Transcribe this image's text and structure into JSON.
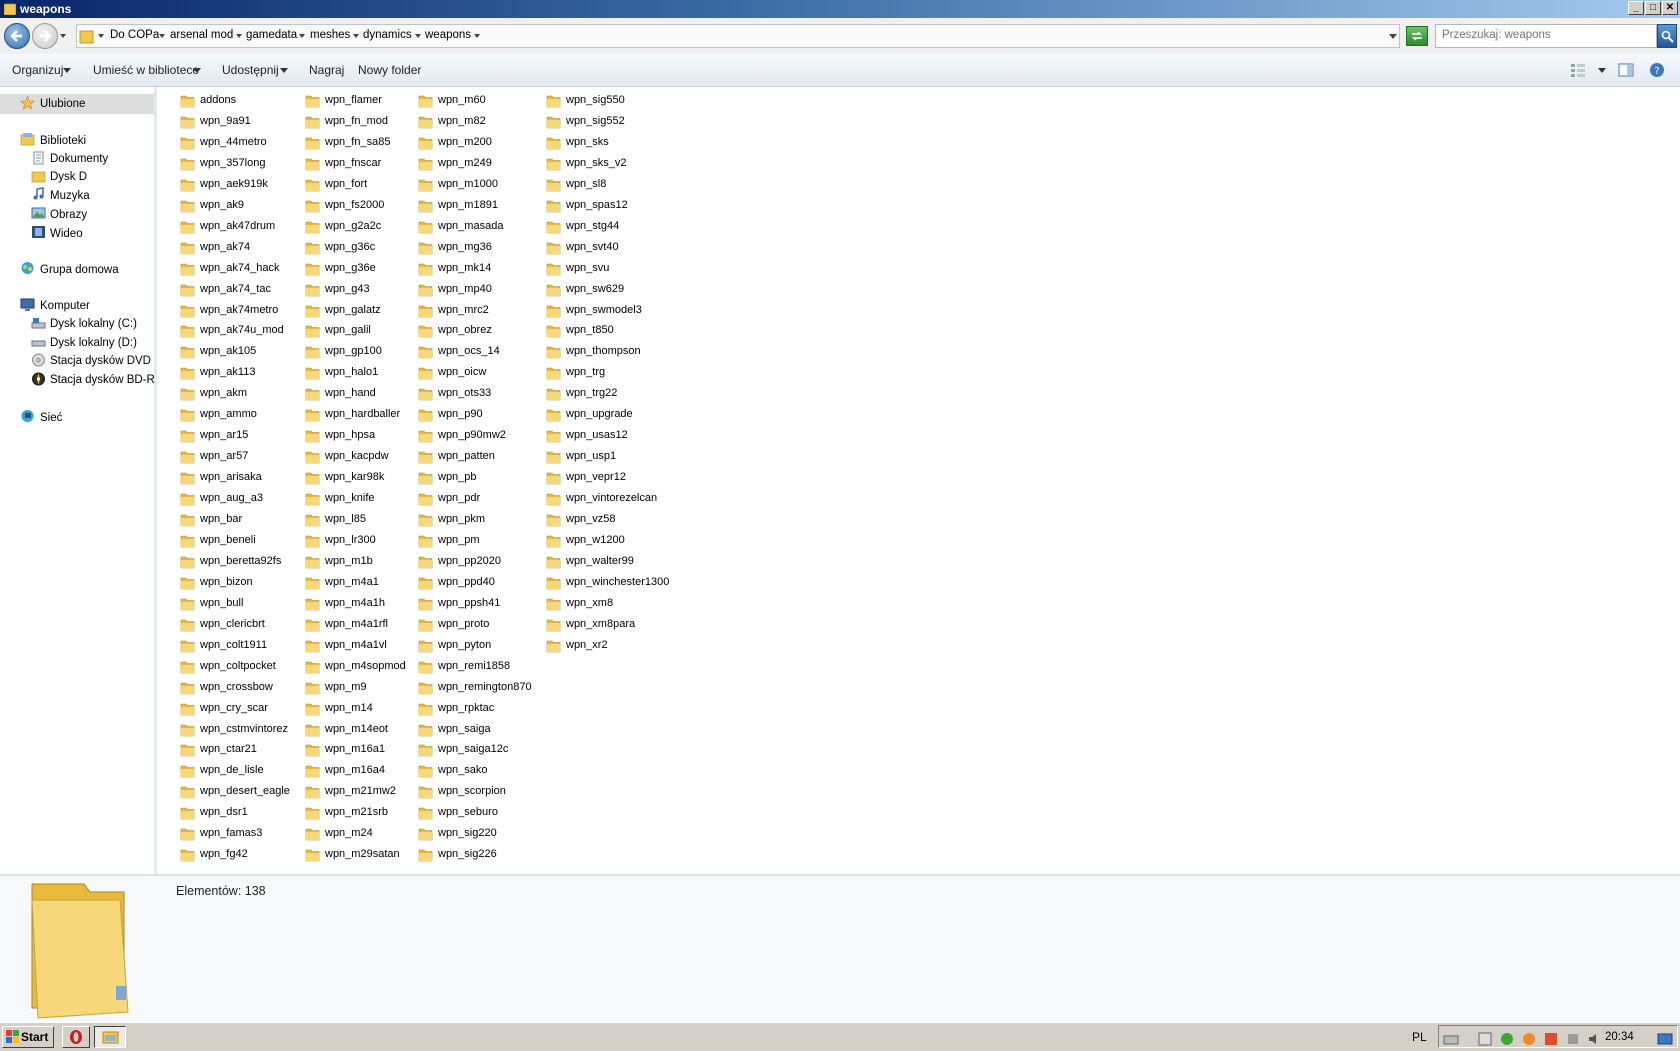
{
  "window": {
    "title": "weapons"
  },
  "window_controls": {
    "minimize": "_",
    "maximize": "□",
    "close": "✕"
  },
  "breadcrumb": [
    "Do COPa",
    "arsenal mod",
    "gamedata",
    "meshes",
    "dynamics",
    "weapons"
  ],
  "search": {
    "placeholder": "Przeszukaj: weapons"
  },
  "toolbar": {
    "organize": "Organizuj",
    "include_library": "Umieść w bibliotece",
    "share": "Udostępnij",
    "burn": "Nagraj",
    "new_folder": "Nowy folder"
  },
  "nav": {
    "favorites": "Ulubione",
    "libraries": "Biblioteki",
    "documents": "Dokumenty",
    "disk_d": "Dysk D",
    "music": "Muzyka",
    "pictures": "Obrazy",
    "video": "Wideo",
    "homegroup": "Grupa domowa",
    "computer": "Komputer",
    "local_c": "Dysk lokalny (C:)",
    "local_d": "Dysk lokalny (D:)",
    "dvd": "Stacja dysków DVD RW",
    "bd": "Stacja dysków BD-ROM",
    "network": "Sieć"
  },
  "files": [
    "addons",
    "wpn_9a91",
    "wpn_44metro",
    "wpn_357long",
    "wpn_aek919k",
    "wpn_ak9",
    "wpn_ak47drum",
    "wpn_ak74",
    "wpn_ak74_hack",
    "wpn_ak74_tac",
    "wpn_ak74metro",
    "wpn_ak74u_mod",
    "wpn_ak105",
    "wpn_ak113",
    "wpn_akm",
    "wpn_ammo",
    "wpn_ar15",
    "wpn_ar57",
    "wpn_arisaka",
    "wpn_aug_a3",
    "wpn_bar",
    "wpn_beneli",
    "wpn_beretta92fs",
    "wpn_bizon",
    "wpn_bull",
    "wpn_clericbrt",
    "wpn_colt1911",
    "wpn_coltpocket",
    "wpn_crossbow",
    "wpn_cry_scar",
    "wpn_cstmvintorez",
    "wpn_ctar21",
    "wpn_de_lisle",
    "wpn_desert_eagle",
    "wpn_dsr1",
    "wpn_famas3",
    "wpn_fg42",
    "wpn_flamer",
    "wpn_fn_mod",
    "wpn_fn_sa85",
    "wpn_fnscar",
    "wpn_fort",
    "wpn_fs2000",
    "wpn_g2a2c",
    "wpn_g36c",
    "wpn_g36e",
    "wpn_g43",
    "wpn_galatz",
    "wpn_galil",
    "wpn_gp100",
    "wpn_halo1",
    "wpn_hand",
    "wpn_hardballer",
    "wpn_hpsa",
    "wpn_kacpdw",
    "wpn_kar98k",
    "wpn_knife",
    "wpn_l85",
    "wpn_lr300",
    "wpn_m1b",
    "wpn_m4a1",
    "wpn_m4a1h",
    "wpn_m4a1rfl",
    "wpn_m4a1vl",
    "wpn_m4sopmod",
    "wpn_m9",
    "wpn_m14",
    "wpn_m14eot",
    "wpn_m16a1",
    "wpn_m16a4",
    "wpn_m21mw2",
    "wpn_m21srb",
    "wpn_m24",
    "wpn_m29satan",
    "wpn_m60",
    "wpn_m82",
    "wpn_m200",
    "wpn_m249",
    "wpn_m1000",
    "wpn_m1891",
    "wpn_masada",
    "wpn_mg36",
    "wpn_mk14",
    "wpn_mp40",
    "wpn_mrc2",
    "wpn_obrez",
    "wpn_ocs_14",
    "wpn_oicw",
    "wpn_ots33",
    "wpn_p90",
    "wpn_p90mw2",
    "wpn_patten",
    "wpn_pb",
    "wpn_pdr",
    "wpn_pkm",
    "wpn_pm",
    "wpn_pp2020",
    "wpn_ppd40",
    "wpn_ppsh41",
    "wpn_proto",
    "wpn_pyton",
    "wpn_remi1858",
    "wpn_remington870",
    "wpn_rpktac",
    "wpn_saiga",
    "wpn_saiga12c",
    "wpn_sako",
    "wpn_scorpion",
    "wpn_seburo",
    "wpn_sig220",
    "wpn_sig226",
    "wpn_sig550",
    "wpn_sig552",
    "wpn_sks",
    "wpn_sks_v2",
    "wpn_sl8",
    "wpn_spas12",
    "wpn_stg44",
    "wpn_svt40",
    "wpn_svu",
    "wpn_sw629",
    "wpn_swmodel3",
    "wpn_t850",
    "wpn_thompson",
    "wpn_trg",
    "wpn_trg22",
    "wpn_upgrade",
    "wpn_usas12",
    "wpn_usp1",
    "wpn_vepr12",
    "wpn_vintorezelcan",
    "wpn_vz58",
    "wpn_w1200",
    "wpn_walter99",
    "wpn_winchester1300",
    "wpn_xm8",
    "wpn_xm8para",
    "wpn_xr2"
  ],
  "details": {
    "item_count": "Elementów: 138"
  },
  "taskbar": {
    "start": "Start",
    "language": "PL",
    "clock": "20:34"
  },
  "colors": {
    "title_bar": "#0a246a",
    "folder": "#f2c94c",
    "selection": "#dcdcdc"
  },
  "icons": {
    "back": "back-arrow-icon",
    "forward": "forward-arrow-icon",
    "folder": "folder-icon",
    "search": "magnifier-icon",
    "refresh": "refresh-icon",
    "star": "star-icon"
  }
}
